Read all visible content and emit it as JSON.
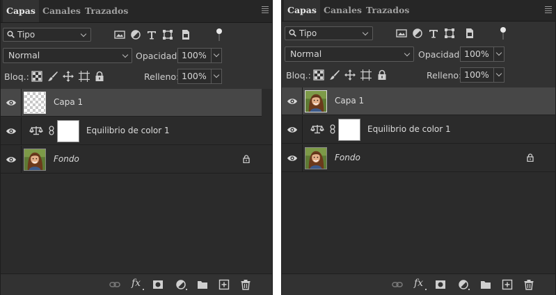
{
  "panels": [
    {
      "tabs": [
        "Capas",
        "Canales",
        "Trazados"
      ],
      "filter": "Tipo",
      "blend_mode": "Normal",
      "opacity_label": "Opacidad:",
      "opacity_value": "100%",
      "lock_label": "Bloq.:",
      "fill_label": "Relleno:",
      "fill_value": "100%",
      "layers": [
        {
          "name": "Capa 1",
          "thumbnail": "transparent-checker",
          "selected": true,
          "italic": false
        },
        {
          "name": "Equilibrio de color 1",
          "type": "adjustment-color-balance",
          "mask": "white"
        },
        {
          "name": "Fondo",
          "thumbnail": "portrait-photo",
          "italic": true,
          "locked": true
        }
      ],
      "icons": {
        "filter": [
          "image-filter-icon",
          "adjustment-filter-icon",
          "type-filter-icon",
          "shape-filter-icon",
          "smart-object-filter-icon"
        ],
        "lock": [
          "lock-transparent-pixels-icon",
          "lock-image-pixels-icon",
          "lock-position-icon",
          "lock-artboard-icon",
          "lock-all-icon"
        ],
        "footer": [
          "link-layers-icon",
          "fx-icon",
          "add-mask-icon",
          "new-adjustment-layer-icon",
          "new-group-icon",
          "new-layer-icon",
          "delete-layer-icon"
        ]
      }
    },
    {
      "tabs": [
        "Capas",
        "Canales",
        "Trazados"
      ],
      "filter": "Tipo",
      "blend_mode": "Normal",
      "opacity_label": "Opacidad:",
      "opacity_value": "100%",
      "lock_label": "Bloq.:",
      "fill_label": "Relleno:",
      "fill_value": "100%",
      "layers": [
        {
          "name": "Capa 1",
          "thumbnail": "portrait-photo",
          "selected": true,
          "italic": false
        },
        {
          "name": "Equilibrio de color 1",
          "type": "adjustment-color-balance",
          "mask": "white"
        },
        {
          "name": "Fondo",
          "thumbnail": "portrait-photo",
          "italic": true,
          "locked": true
        }
      ],
      "icons": {
        "filter": [
          "image-filter-icon",
          "adjustment-filter-icon",
          "type-filter-icon",
          "shape-filter-icon",
          "smart-object-filter-icon"
        ],
        "lock": [
          "lock-transparent-pixels-icon",
          "lock-image-pixels-icon",
          "lock-position-icon",
          "lock-artboard-icon",
          "lock-all-icon"
        ],
        "footer": [
          "link-layers-icon",
          "fx-icon",
          "add-mask-icon",
          "new-adjustment-layer-icon",
          "new-group-icon",
          "new-layer-icon",
          "delete-layer-icon"
        ]
      }
    }
  ],
  "colors": {
    "panel_bg": "#323232",
    "tab_bar_bg": "#262626",
    "layer_list_bg": "#2b2b2b",
    "selected_layer_bg": "#474747",
    "text": "#d6d6d6"
  }
}
